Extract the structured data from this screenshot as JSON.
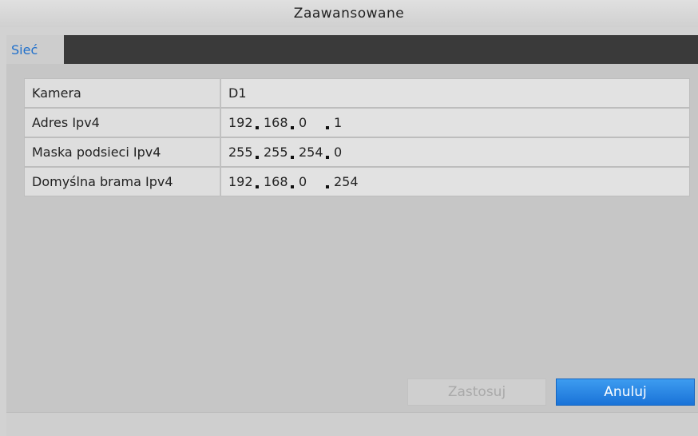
{
  "window": {
    "title": "Zaawansowane"
  },
  "tabs": [
    {
      "label": "Sieć",
      "active": true
    }
  ],
  "form": {
    "rows": [
      {
        "label": "Kamera",
        "value": "D1"
      },
      {
        "label": "Adres Ipv4",
        "octets": [
          "192",
          "168",
          "0",
          "1"
        ]
      },
      {
        "label": "Maska podsieci Ipv4",
        "octets": [
          "255",
          "255",
          "254",
          "0"
        ]
      },
      {
        "label": "Domyślna brama Ipv4",
        "octets": [
          "192",
          "168",
          "0",
          "254"
        ]
      }
    ]
  },
  "buttons": {
    "apply": {
      "label": "Zastosuj",
      "enabled": false
    },
    "cancel": {
      "label": "Anuluj",
      "enabled": true
    }
  },
  "colors": {
    "accent": "#1a73d8",
    "tab_text": "#1f6fcb",
    "tab_bar": "#3a3a3a"
  }
}
